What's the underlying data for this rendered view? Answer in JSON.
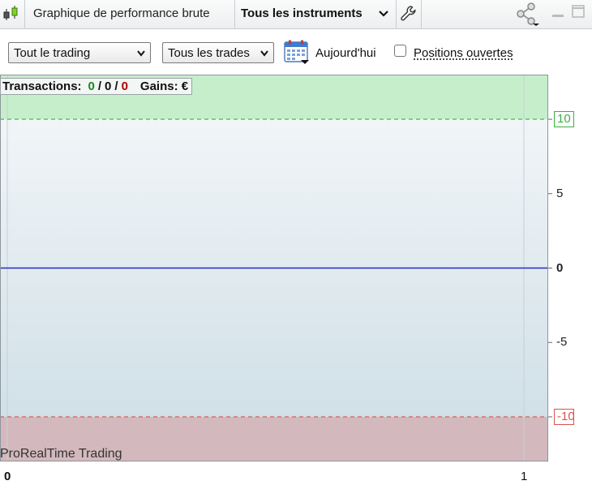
{
  "titlebar": {
    "title": "Graphique de performance brute",
    "instrument_filter": "Tous les instruments"
  },
  "toolbar": {
    "trading_select": "Tout le trading",
    "trades_select": "Tous les trades",
    "today_label": "Aujourd'hui",
    "open_positions_label": "Positions ouvertes",
    "open_positions_checked": false
  },
  "summary": {
    "transactions_label": "Transactions:",
    "winning": "0",
    "separator": "/",
    "neutral": "0",
    "losing": "0",
    "gains_label": "Gains: €"
  },
  "watermark": "ProRealTime Trading",
  "colors": {
    "win_zone": "#c6eecb",
    "loss_zone": "#d3b9bd",
    "zero_line": "#1f2fbf",
    "upper_threshold": "#3cb043",
    "lower_threshold": "#d9534f"
  },
  "chart_data": {
    "type": "line",
    "x": [
      0,
      1
    ],
    "series": [
      {
        "values": [
          0,
          0
        ]
      }
    ],
    "xlim": [
      0,
      1
    ],
    "ylim": [
      -13,
      13
    ],
    "x_ticks": [
      "0",
      "1"
    ],
    "y_ticks": [
      "10",
      "5",
      "0",
      "-5",
      "-10"
    ],
    "upper_threshold": 10,
    "lower_threshold": -10,
    "grid": true
  }
}
